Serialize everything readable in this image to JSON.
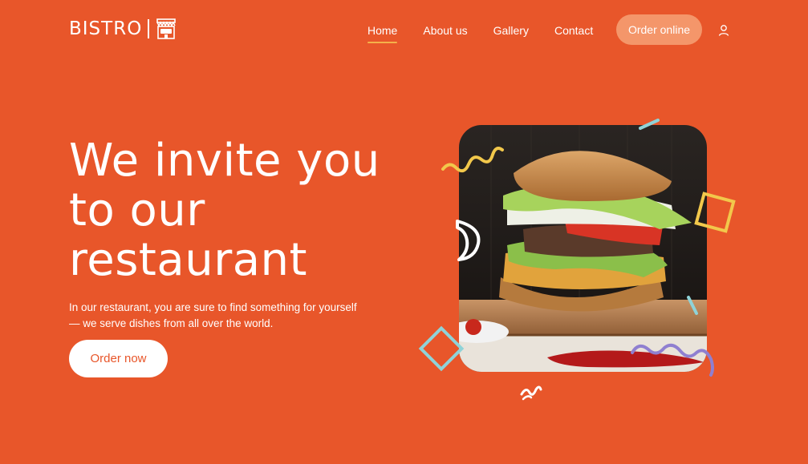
{
  "header": {
    "logo_text": "BISTRO",
    "logo_icon": "restaurant-storefront-icon",
    "nav": [
      {
        "label": "Home",
        "active": true
      },
      {
        "label": "About us",
        "active": false
      },
      {
        "label": "Gallery",
        "active": false
      },
      {
        "label": "Contact",
        "active": false
      }
    ],
    "order_online_label": "Order online",
    "user_icon": "user-icon"
  },
  "hero": {
    "title_line1": "We invite you",
    "title_line2": "to our",
    "title_line3": "restaurant",
    "description_line1": "In our restaurant, you are sure to find something for yourself",
    "description_line2": "— we serve dishes from all over the world.",
    "order_now_label": "Order now",
    "image": "burger-photo"
  },
  "colors": {
    "background": "#E8562A",
    "accent_underline": "#F5B14A",
    "order_online_bg": "#F4966A",
    "button_white": "#FFFFFF",
    "deco_yellow": "#F2C84B",
    "deco_teal": "#8FD3D8",
    "deco_purple": "#8F7FD0"
  }
}
